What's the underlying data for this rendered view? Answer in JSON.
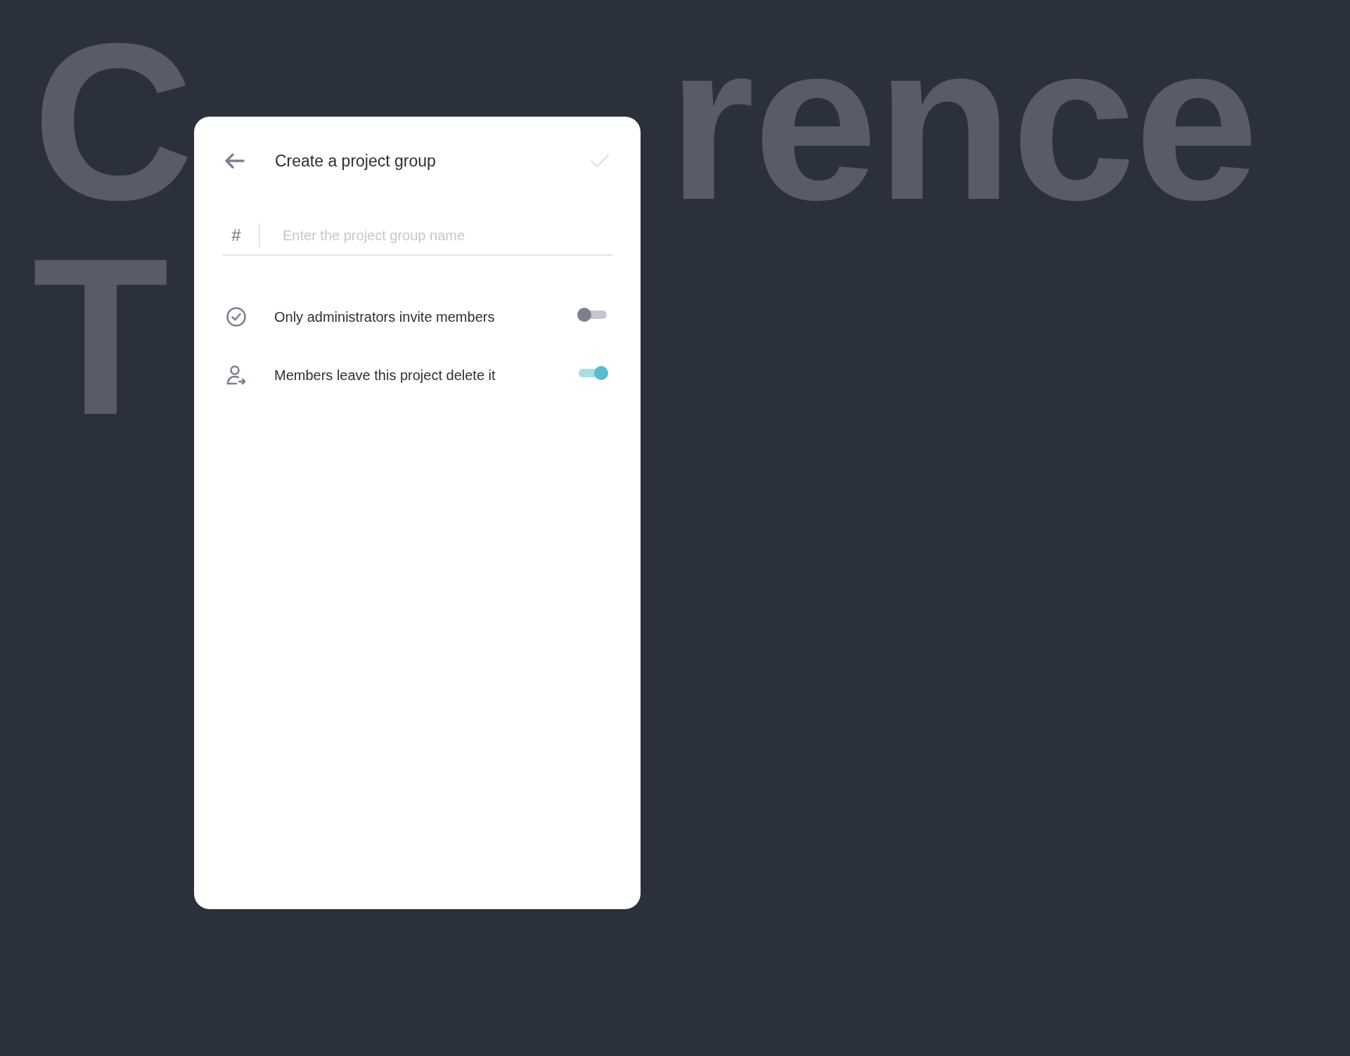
{
  "backdrop": {
    "lines": [
      [
        "C",
        "rence"
      ],
      [
        "T"
      ]
    ]
  },
  "dialog": {
    "title": "Create a project group",
    "confirm_disabled": true,
    "name_field": {
      "prefix": "#",
      "placeholder": "Enter the project group name"
    },
    "options": [
      {
        "kind": "admin",
        "label": "Only administrators invite members",
        "on": false
      },
      {
        "kind": "leave",
        "label": "Members leave this project delete it",
        "on": true
      }
    ]
  }
}
